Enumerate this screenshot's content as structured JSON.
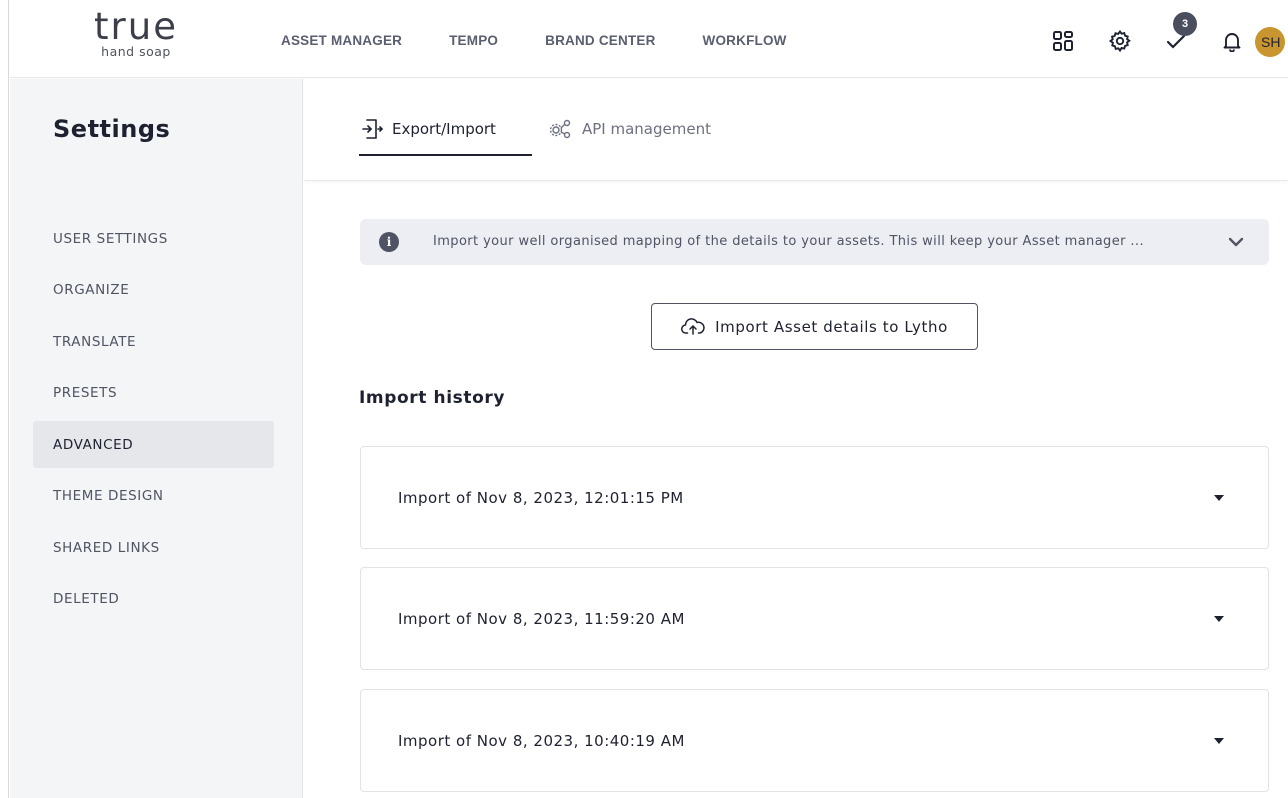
{
  "logo": {
    "main": "true",
    "sub": "hand soap"
  },
  "topnav": [
    "ASSET MANAGER",
    "TEMPO",
    "BRAND CENTER",
    "WORKFLOW"
  ],
  "header_icons": {
    "apps": "grid-icon",
    "settings": "gear-icon",
    "tasks": "check-icon",
    "notifications": "bell-icon",
    "tasks_badge": "3"
  },
  "avatar": {
    "initials": "SH",
    "color": "#c9952e"
  },
  "sidebar": {
    "title": "Settings",
    "items": [
      {
        "label": "USER SETTINGS"
      },
      {
        "label": "ORGANIZE"
      },
      {
        "label": "TRANSLATE"
      },
      {
        "label": "PRESETS"
      },
      {
        "label": "ADVANCED",
        "active": true
      },
      {
        "label": "THEME DESIGN"
      },
      {
        "label": "SHARED LINKS"
      },
      {
        "label": "DELETED"
      }
    ]
  },
  "tabs": [
    {
      "label": "Export/Import",
      "icon": "export-import-icon",
      "active": true
    },
    {
      "label": "API management",
      "icon": "api-gears-icon",
      "active": false
    }
  ],
  "info_banner": {
    "text": "Import your well organised mapping of the details to your assets. This will keep your Asset manager ..."
  },
  "import_button": {
    "label": "Import Asset details to Lytho",
    "icon": "cloud-upload-icon"
  },
  "history": {
    "title": "Import history",
    "items": [
      {
        "label": "Import of Nov 8, 2023, 12:01:15 PM"
      },
      {
        "label": "Import of Nov 8, 2023, 11:59:20 AM"
      },
      {
        "label": "Import of Nov 8, 2023, 10:40:19 AM"
      }
    ]
  }
}
